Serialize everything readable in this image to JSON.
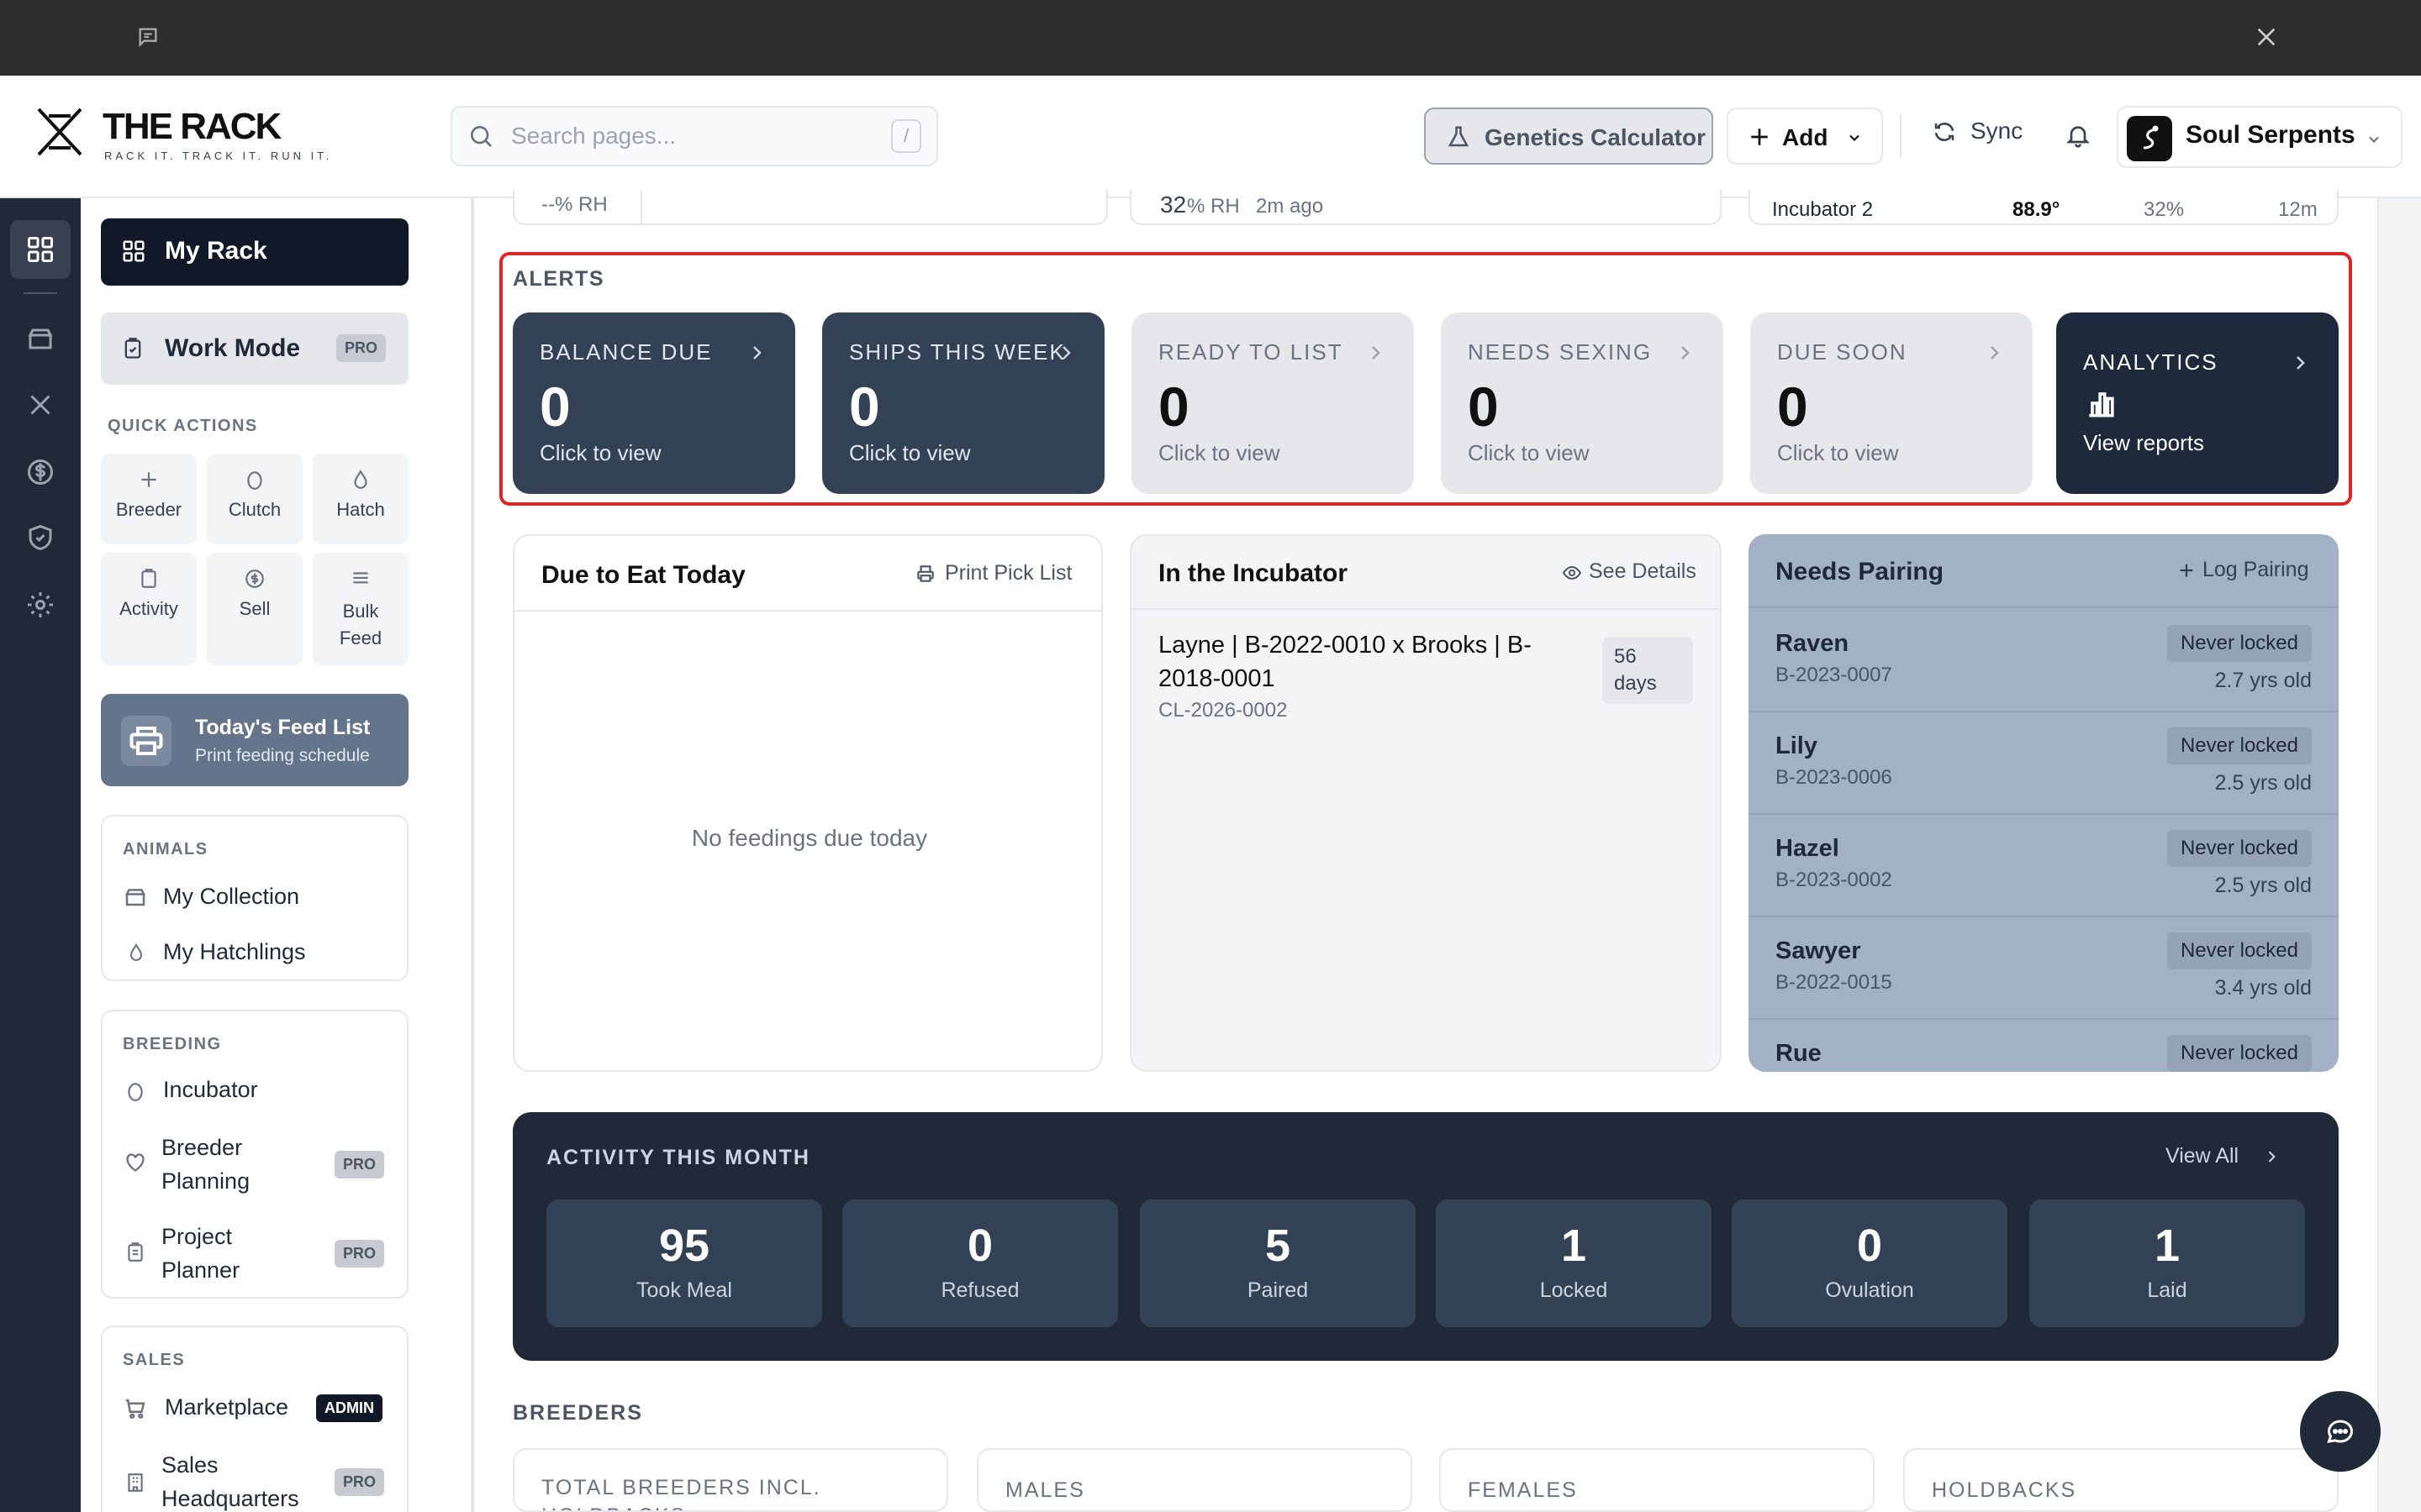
{
  "brand": {
    "title": "THE RACK",
    "tagline": "RACK IT. TRACK IT. RUN IT."
  },
  "header": {
    "search_placeholder": "Search pages...",
    "search_shortcut": "/",
    "genetics_label": "Genetics Calculator",
    "add_label": "Add",
    "sync_label": "Sync",
    "account_name": "Soul Serpents"
  },
  "sidebar": {
    "my_rack": "My Rack",
    "work_mode": "Work Mode",
    "pro": "PRO",
    "admin": "ADMIN",
    "quick_actions_label": "QUICK ACTIONS",
    "quick_actions": [
      "Breeder",
      "Clutch",
      "Hatch",
      "Activity",
      "Sell",
      "Bulk Feed"
    ],
    "feed_list_title": "Today's Feed List",
    "feed_list_sub": "Print feeding schedule",
    "animals_label": "ANIMALS",
    "my_collection": "My Collection",
    "my_hatchlings": "My Hatchlings",
    "breeding_label": "BREEDING",
    "incubator": "Incubator",
    "breeder_planning": "Breeder Planning",
    "project_planner": "Project Planner",
    "sales_label": "SALES",
    "marketplace": "Marketplace",
    "sales_hq": "Sales Headquarters"
  },
  "top_peek": {
    "rh_left": "--% RH",
    "rh_mid_value": "32",
    "rh_mid_unit": "% RH",
    "rh_mid_time": "2m ago",
    "inc_name": "Incubator 2",
    "inc_temp": "88.9°",
    "inc_rh": "32%",
    "inc_time": "12m"
  },
  "alerts": {
    "label": "ALERTS",
    "cards": [
      {
        "title": "BALANCE DUE",
        "value": "0",
        "sub": "Click to view"
      },
      {
        "title": "SHIPS THIS WEEK",
        "value": "0",
        "sub": "Click to view"
      },
      {
        "title": "READY TO LIST",
        "value": "0",
        "sub": "Click to view"
      },
      {
        "title": "NEEDS SEXING",
        "value": "0",
        "sub": "Click to view"
      },
      {
        "title": "DUE SOON",
        "value": "0",
        "sub": "Click to view"
      },
      {
        "title": "ANALYTICS",
        "sub": "View reports"
      }
    ]
  },
  "due_to_eat": {
    "title": "Due to Eat Today",
    "action": "Print Pick List",
    "empty": "No feedings due today"
  },
  "incubator_panel": {
    "title": "In the Incubator",
    "action": "See Details",
    "item_title": "Layne | B-2022-0010 x Brooks | B-2018-0001",
    "item_id": "CL-2026-0002",
    "item_days": "56 days"
  },
  "needs_pairing": {
    "title": "Needs Pairing",
    "action": "Log Pairing",
    "rows": [
      {
        "name": "Raven",
        "id": "B-2023-0007",
        "status": "Never locked",
        "age": "2.7 yrs old"
      },
      {
        "name": "Lily",
        "id": "B-2023-0006",
        "status": "Never locked",
        "age": "2.5 yrs old"
      },
      {
        "name": "Hazel",
        "id": "B-2023-0002",
        "status": "Never locked",
        "age": "2.5 yrs old"
      },
      {
        "name": "Sawyer",
        "id": "B-2022-0015",
        "status": "Never locked",
        "age": "3.4 yrs old"
      },
      {
        "name": "Rue",
        "id": "",
        "status": "Never locked",
        "age": ""
      }
    ]
  },
  "activity": {
    "title": "ACTIVITY THIS MONTH",
    "view_all": "View All",
    "stats": [
      {
        "value": "95",
        "label": "Took Meal"
      },
      {
        "value": "0",
        "label": "Refused"
      },
      {
        "value": "5",
        "label": "Paired"
      },
      {
        "value": "1",
        "label": "Locked"
      },
      {
        "value": "0",
        "label": "Ovulation"
      },
      {
        "value": "1",
        "label": "Laid"
      }
    ]
  },
  "breeders": {
    "label": "BREEDERS",
    "cards": [
      "TOTAL BREEDERS INCL. HOLDBACKS",
      "MALES",
      "FEMALES",
      "HOLDBACKS"
    ]
  }
}
